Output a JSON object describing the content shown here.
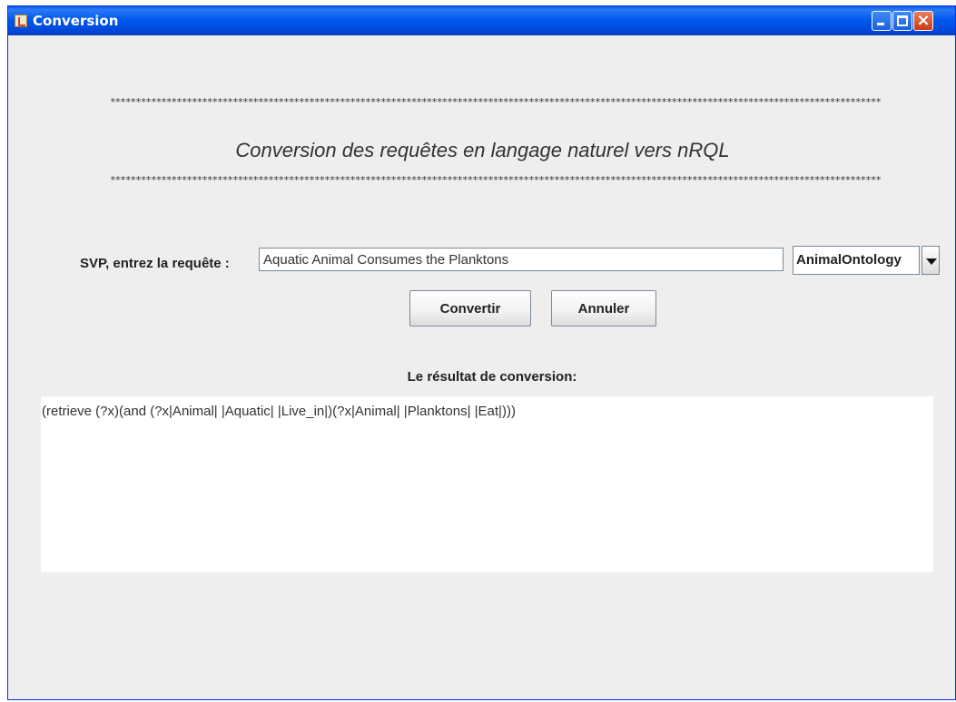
{
  "window": {
    "title": "Conversion",
    "buttons": {
      "minimize": "minimize",
      "maximize": "maximize",
      "close": "×"
    }
  },
  "header": {
    "stars_top": "*****************************************************************************************************************************************************************************************************************************",
    "heading": "Conversion des requêtes en langage naturel vers nRQL",
    "stars_bottom": "*****************************************************************************************************************************************************************************************************************************"
  },
  "form": {
    "query_label": "SVP, entrez la requête :",
    "query_value": "Aquatic Animal Consumes the Planktons",
    "ontology_selected": "AnimalOntology",
    "convert_label": "Convertir",
    "cancel_label": "Annuler"
  },
  "result": {
    "label": "Le résultat de conversion:",
    "text": "(retrieve (?x)(and (?x|Animal| |Aquatic| |Live_in|)(?x|Animal| |Planktons| |Eat|)))"
  },
  "colors": {
    "titlebar": "#0058ee",
    "background": "#eeeeee",
    "close_button": "#c63b14"
  }
}
